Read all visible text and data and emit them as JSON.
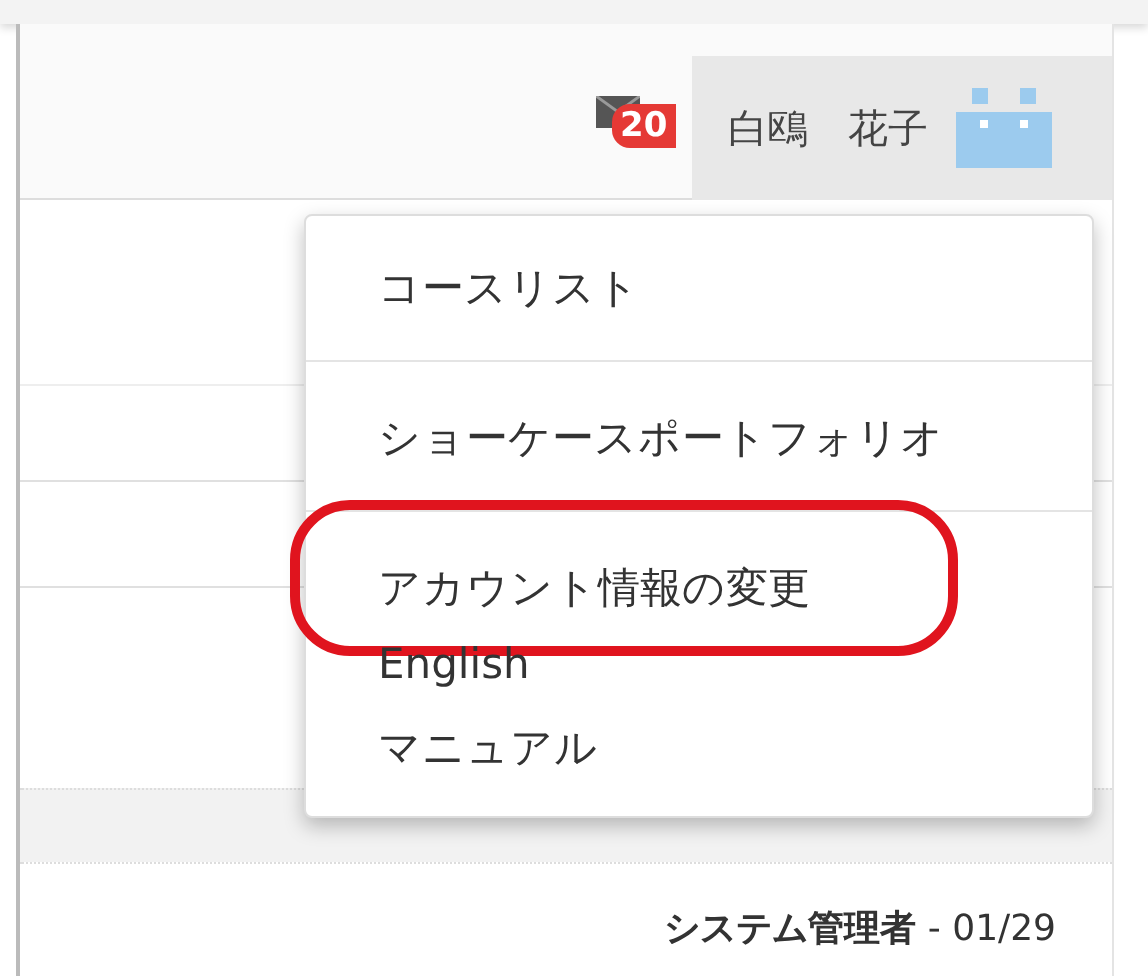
{
  "header": {
    "message_count": "20",
    "user_name": "白鴎　花子"
  },
  "user_menu": {
    "items": [
      {
        "label": "コースリスト",
        "divider_after": true,
        "highlighted": false
      },
      {
        "label": "ショーケースポートフォリオ",
        "divider_after": true,
        "highlighted": false
      },
      {
        "label": "アカウント情報の変更",
        "divider_after": false,
        "highlighted": true
      },
      {
        "label": "English",
        "divider_after": false,
        "highlighted": false
      },
      {
        "label": "マニュアル",
        "divider_after": false,
        "highlighted": false
      }
    ]
  },
  "list": {
    "rows": [
      {
        "text": "**システム管理者** - 01/29"
      }
    ]
  }
}
